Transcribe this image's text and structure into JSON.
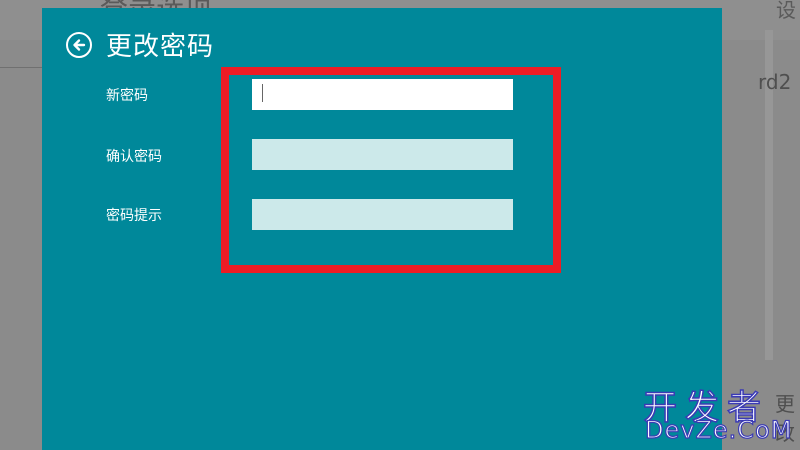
{
  "background": {
    "heading": "登录选项",
    "top_right_char": "设",
    "right_text": "rd2",
    "right_text_lower": "更改"
  },
  "dialog": {
    "title": "更改密码",
    "back_icon": "back-arrow-circle-icon",
    "fields": [
      {
        "label": "新密码",
        "value": "",
        "state": "active"
      },
      {
        "label": "确认密码",
        "value": "",
        "state": "inactive"
      },
      {
        "label": "密码提示",
        "value": "",
        "state": "inactive"
      }
    ],
    "highlight_color": "#ed1c24",
    "bg_color": "#00889a"
  },
  "watermark": {
    "cn": "开发者",
    "en": "DevZe.CoM"
  }
}
